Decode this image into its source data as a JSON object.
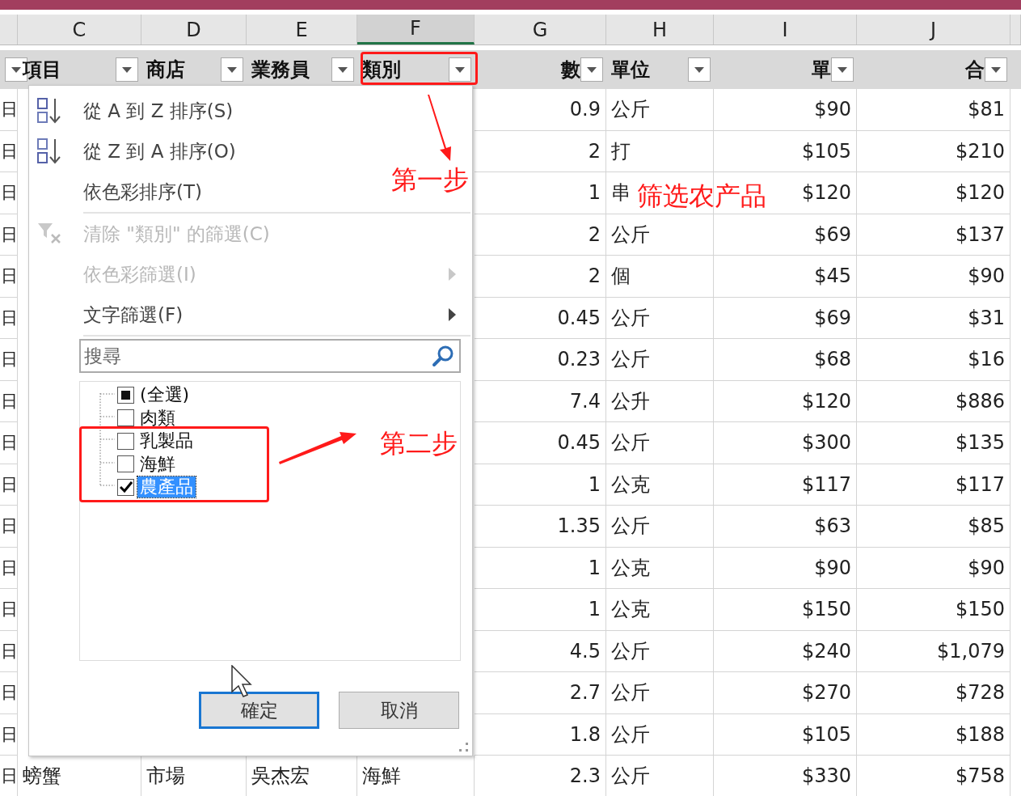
{
  "columns": [
    {
      "label": "C",
      "selected": false
    },
    {
      "label": "D",
      "selected": false
    },
    {
      "label": "E",
      "selected": false
    },
    {
      "label": "F",
      "selected": true
    },
    {
      "label": "G",
      "selected": false
    },
    {
      "label": "H",
      "selected": false
    },
    {
      "label": "I",
      "selected": false
    },
    {
      "label": "J",
      "selected": false
    }
  ],
  "header_fields": [
    {
      "label": "項目",
      "numeric": false
    },
    {
      "label": "商店",
      "numeric": false
    },
    {
      "label": "業務員",
      "numeric": false
    },
    {
      "label": "類別",
      "numeric": false
    },
    {
      "label": "數",
      "numeric": true
    },
    {
      "label": "單位",
      "numeric": false
    },
    {
      "label": "單",
      "numeric": true
    },
    {
      "label": "合",
      "numeric": true
    }
  ],
  "rows": [
    {
      "column_b": "日",
      "quantity": "0.9",
      "unit": "公斤",
      "price": "$90",
      "total": "$81"
    },
    {
      "column_b": "日",
      "quantity": "2",
      "unit": "打",
      "price": "$105",
      "total": "$210"
    },
    {
      "column_b": "日",
      "quantity": "1",
      "unit": "串",
      "price": "$120",
      "total": "$120"
    },
    {
      "column_b": "日",
      "quantity": "2",
      "unit": "公斤",
      "price": "$69",
      "total": "$137"
    },
    {
      "column_b": "日",
      "quantity": "2",
      "unit": "個",
      "price": "$45",
      "total": "$90"
    },
    {
      "column_b": "日",
      "quantity": "0.45",
      "unit": "公斤",
      "price": "$69",
      "total": "$31"
    },
    {
      "column_b": "日",
      "quantity": "0.23",
      "unit": "公斤",
      "price": "$68",
      "total": "$16"
    },
    {
      "column_b": "日",
      "quantity": "7.4",
      "unit": "公升",
      "price": "$120",
      "total": "$886"
    },
    {
      "column_b": "日",
      "quantity": "0.45",
      "unit": "公斤",
      "price": "$300",
      "total": "$135"
    },
    {
      "column_b": "日",
      "quantity": "1",
      "unit": "公克",
      "price": "$117",
      "total": "$117"
    },
    {
      "column_b": "日",
      "quantity": "1.35",
      "unit": "公斤",
      "price": "$63",
      "total": "$85"
    },
    {
      "column_b": "日",
      "quantity": "1",
      "unit": "公克",
      "price": "$90",
      "total": "$90"
    },
    {
      "column_b": "日",
      "quantity": "1",
      "unit": "公克",
      "price": "$150",
      "total": "$150"
    },
    {
      "column_b": "日",
      "quantity": "4.5",
      "unit": "公斤",
      "price": "$240",
      "total": "$1,079"
    },
    {
      "column_b": "日",
      "quantity": "2.7",
      "unit": "公斤",
      "price": "$270",
      "total": "$728"
    },
    {
      "column_b": "日",
      "quantity": "1.8",
      "unit": "公斤",
      "price": "$105",
      "total": "$188"
    },
    {
      "column_b": "日",
      "item": "螃蟹",
      "store": "市場",
      "staff": "吳杰宏",
      "category": "海鮮",
      "quantity": "2.3",
      "unit": "公斤",
      "price": "$330",
      "total": "$758"
    }
  ],
  "filter_menu": {
    "items": [
      {
        "kind": "sort_az",
        "label": "從 A 到 Z 排序(S)",
        "disabled": false,
        "submenu": false
      },
      {
        "kind": "sort_za",
        "label": "從 Z 到 A 排序(O)",
        "disabled": false,
        "submenu": false
      },
      {
        "kind": "plain",
        "label": "依色彩排序(T)",
        "disabled": false,
        "submenu": false
      },
      {
        "kind": "separator"
      },
      {
        "kind": "clear",
        "label": "清除 \"類別\" 的篩選(C)",
        "disabled": true,
        "submenu": false
      },
      {
        "kind": "plain",
        "label": "依色彩篩選(I)",
        "disabled": true,
        "submenu": true
      },
      {
        "kind": "plain",
        "label": "文字篩選(F)",
        "disabled": false,
        "submenu": true
      },
      {
        "kind": "separator"
      }
    ],
    "search": {
      "placeholder": "搜尋"
    },
    "checklist": [
      {
        "label": "(全選)",
        "checked": false,
        "indeterminate": true,
        "selected": false
      },
      {
        "label": "肉類",
        "checked": false,
        "indeterminate": false,
        "selected": false
      },
      {
        "label": "乳製品",
        "checked": false,
        "indeterminate": false,
        "selected": false
      },
      {
        "label": "海鮮",
        "checked": false,
        "indeterminate": false,
        "selected": false
      },
      {
        "label": "農產品",
        "checked": true,
        "indeterminate": false,
        "selected": true
      }
    ],
    "buttons": [
      {
        "label": "確定",
        "focused": true
      },
      {
        "label": "取消",
        "focused": false
      }
    ]
  },
  "annotations": [
    {
      "text": "第一步"
    },
    {
      "text": "第二步"
    },
    {
      "text": "筛选农产品"
    }
  ]
}
